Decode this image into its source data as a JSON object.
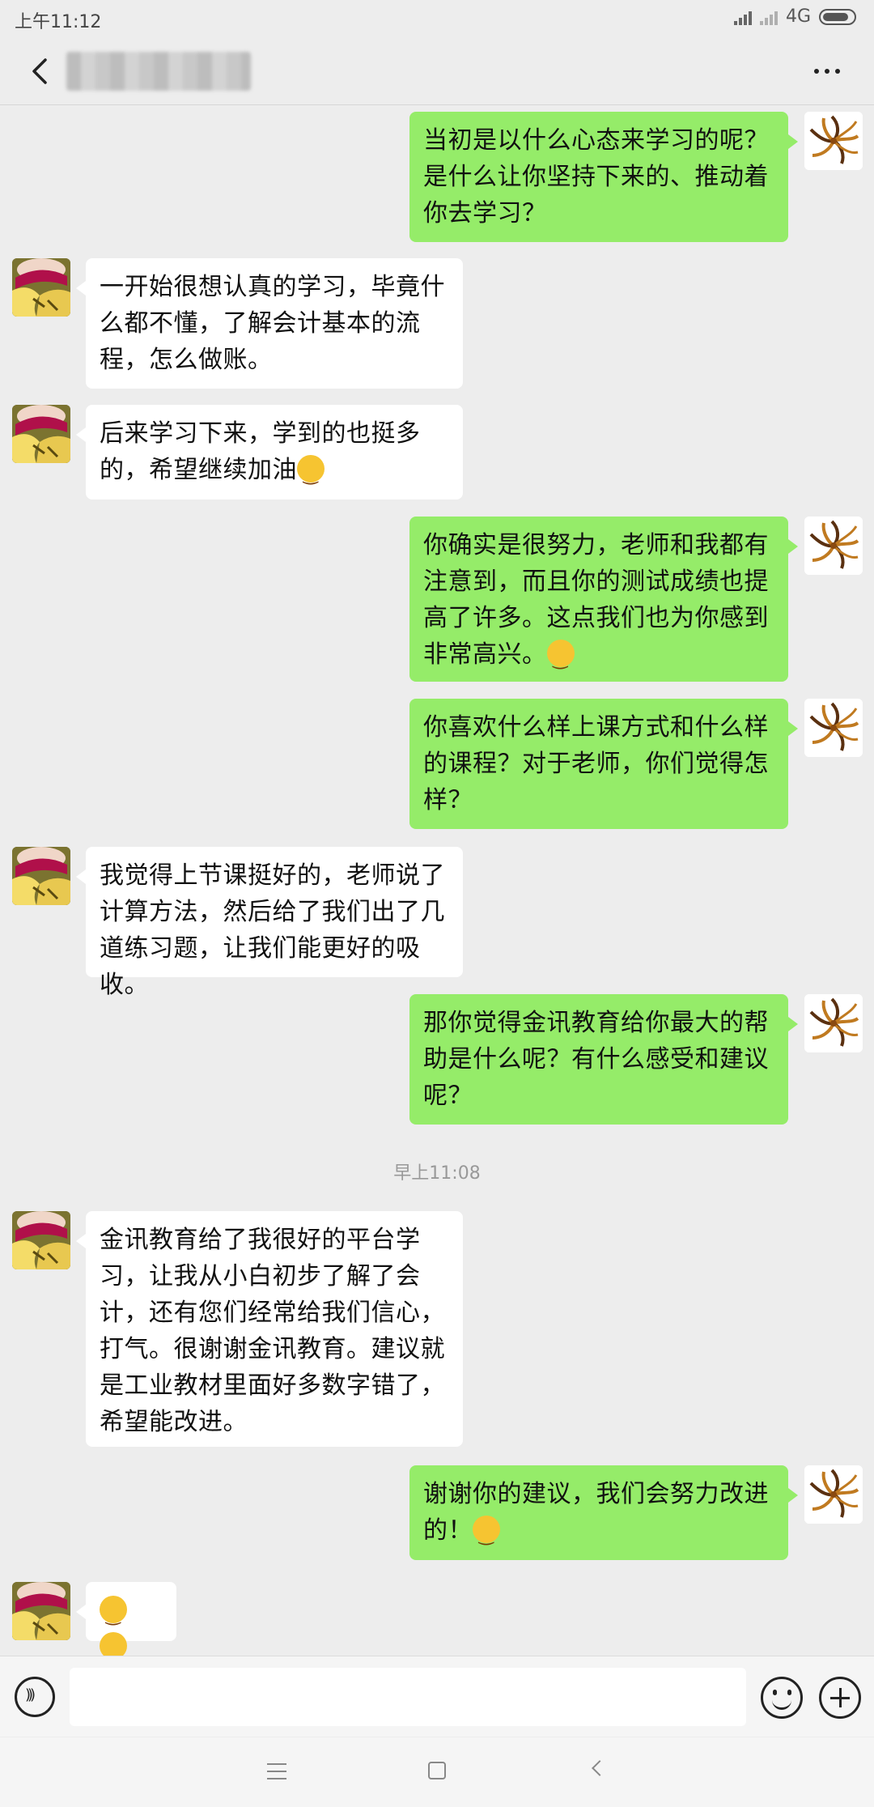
{
  "status_bar": {
    "time": "上午11:12",
    "network": "4G",
    "battery_level": 0.85
  },
  "header": {
    "contact_name_blurred": true
  },
  "messages": [
    {
      "side": "right",
      "text": "当初是以什么心态来学习的呢？是什么让你坚持下来的、推动着你去学习？"
    },
    {
      "side": "left",
      "text": "一开始很想认真的学习，毕竟什么都不懂，了解会计基本的流程，怎么做账。"
    },
    {
      "side": "left",
      "text": "后来学习下来，学到的也挺多的，希望继续加油"
    },
    {
      "side": "right",
      "text": "你确实是很努力，老师和我都有注意到，而且你的测试成绩也提高了许多。这点我们也为你感到非常高兴。"
    },
    {
      "side": "right",
      "text": "你喜欢什么样上课方式和什么样的课程？对于老师，你们觉得怎样？"
    },
    {
      "side": "left",
      "text": "我觉得上节课挺好的，老师说了计算方法，然后给了我们出了几道练习题，让我们能更好的吸收。"
    },
    {
      "side": "right",
      "text": "那你觉得金讯教育给你最大的帮助是什么呢？有什么感受和建议呢？"
    },
    {
      "side": "left",
      "text": "金讯教育给了我很好的平台学习，让我从小白初步了解了会计，还有您们经常给我们信心，打气。很谢谢金讯教育。建议就是工业教材里面好多数字错了，希望能改进。"
    },
    {
      "side": "right",
      "text": "谢谢你的建议，我们会努力改进的！"
    },
    {
      "side": "left",
      "text": ""
    }
  ],
  "time_divider": "早上11:08",
  "input": {
    "value": "",
    "placeholder": ""
  },
  "icons": {
    "back": "back-arrow-icon",
    "more": "more-dots-icon",
    "voice": "voice-icon",
    "emoji": "emoji-icon",
    "plus": "plus-icon",
    "nav_menu": "menu-icon",
    "nav_home": "home-icon",
    "nav_back": "back-icon"
  },
  "colors": {
    "sent_bubble": "#95ec69",
    "received_bubble": "#ffffff",
    "background": "#ededed"
  }
}
